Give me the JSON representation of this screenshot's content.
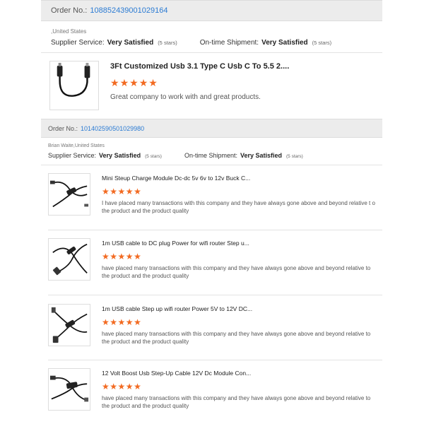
{
  "orders": [
    {
      "order_label": "Order No.:",
      "order_no": "108852439001029164",
      "location": ",United States",
      "supplier_label": "Supplier Service:",
      "supplier_value": "Very Satisfied",
      "supplier_stars": "(5 stars)",
      "shipment_label": "On-time Shipment:",
      "shipment_value": "Very Satisfied",
      "shipment_stars": "(5 stars)"
    },
    {
      "order_label": "Order No.:",
      "order_no": "101402590501029980",
      "location": "Brian Waite,United States",
      "supplier_label": "Supplier Service:",
      "supplier_value": "Very Satisfied",
      "supplier_stars": "(5 stars)",
      "shipment_label": "On-time Shipment:",
      "shipment_value": "Very Satisfied",
      "shipment_stars": "(5 stars)"
    }
  ],
  "products": [
    {
      "title": "3Ft Customized Usb 3.1 Type C Usb C To 5.5 2....",
      "rating": 5,
      "review": "Great company to work with and great products.",
      "icon": "usb-c-cable-icon"
    },
    {
      "title": "Mini Steup Charge Module Dc-dc 5v 6v to 12v Buck C...",
      "rating": 5,
      "review": "I have placed many transactions with this company and they have always gone above and beyond relative t o the product and the product quality",
      "icon": "usb-boost-cable-icon"
    },
    {
      "title": "1m USB cable to DC plug Power for wifi router Step u...",
      "rating": 5,
      "review": "have placed many transactions with this company and they have always gone above and beyond relative to the product and the product quality",
      "icon": "usb-dc-cable-icon"
    },
    {
      "title": "1m USB cable Step up wifi router Power 5V to 12V DC...",
      "rating": 5,
      "review": "have placed many transactions with this company and they have always gone above and beyond relative to the product and the product quality",
      "icon": "usb-step-up-cable-icon"
    },
    {
      "title": "12 Volt Boost Usb Step-Up Cable 12V Dc Module Con...",
      "rating": 5,
      "review": "have placed many transactions with this company and they have always gone above and beyond relative to the product and the product quality",
      "icon": "usb-boost-module-cable-icon"
    }
  ],
  "star_glyph": "★",
  "colors": {
    "link": "#2b7bd3",
    "star": "#f26a21",
    "header_bg": "#ececec"
  }
}
